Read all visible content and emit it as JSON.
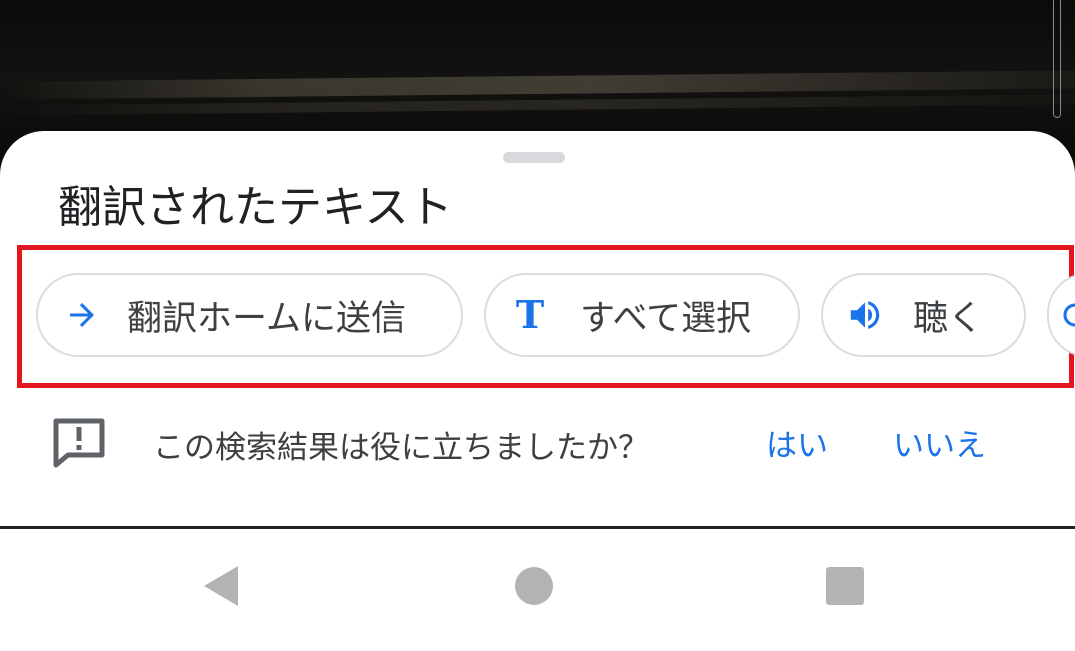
{
  "sheet": {
    "title": "翻訳されたテキスト"
  },
  "actions": [
    {
      "label": "翻訳ホームに送信",
      "icon": "arrow-right-icon"
    },
    {
      "label": "すべて選択",
      "icon": "text-t-icon",
      "icon_text": "T"
    },
    {
      "label": "聴く",
      "icon": "speaker-icon"
    },
    {
      "label": "",
      "icon": "partially-hidden-icon"
    }
  ],
  "feedback": {
    "question": "この検索結果は役に立ちましたか？",
    "yes_label": "はい",
    "no_label": "いいえ",
    "icon": "feedback-icon"
  },
  "navbar": {
    "back_icon": "back-triangle-icon",
    "home_icon": "home-circle-icon",
    "recent_icon": "recents-square-icon"
  },
  "colors": {
    "accent": "#1a73e8",
    "highlight": "#e3151f",
    "text": "#202124",
    "chip_border": "#dadce0",
    "nav_icon": "#b3b3b3"
  }
}
